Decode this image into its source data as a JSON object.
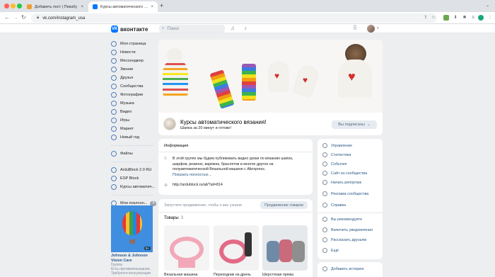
{
  "browser": {
    "tabs": [
      {
        "title": "Добавить пост | Пикабу",
        "active": false
      },
      {
        "title": "Курсы автоматического вязания!",
        "active": true
      }
    ],
    "url": "vk.com/instagram_usa"
  },
  "header": {
    "logo": "вконтакте",
    "search_placeholder": "Поиск"
  },
  "leftnav": {
    "items": [
      {
        "label": "Моя страница",
        "icon": "user-icon"
      },
      {
        "label": "Новости",
        "icon": "news-icon"
      },
      {
        "label": "Мессенджер",
        "icon": "chat-icon"
      },
      {
        "label": "Звонки",
        "icon": "phone-icon"
      },
      {
        "label": "Друзья",
        "icon": "friends-icon"
      },
      {
        "label": "Сообщества",
        "icon": "groups-icon"
      },
      {
        "label": "Фотографии",
        "icon": "photo-icon"
      },
      {
        "label": "Музыка",
        "icon": "music-icon"
      },
      {
        "label": "Видео",
        "icon": "video-icon"
      },
      {
        "label": "Игры",
        "icon": "games-icon"
      },
      {
        "label": "Маркет",
        "icon": "market-icon"
      },
      {
        "label": "Новый год",
        "icon": "newyear-icon"
      }
    ],
    "files": "Файлы",
    "apps": [
      "ArduBlock 2.0 RU",
      "ESP Block",
      "Курсы автоматич..."
    ],
    "more_label": "Мои поклонн...",
    "more_badge": "4"
  },
  "ad": {
    "label": "0+",
    "title": "Johnson & Johnson Vision Care",
    "type": "Группа",
    "desc": "Есть противопоказания. Требуется консультация"
  },
  "group": {
    "name": "Курсы автоматического вязания!",
    "status": "Шапка за 20 минут и готово!",
    "subscribe_label": "Вы подписаны"
  },
  "info": {
    "title": "Информация",
    "description": "В этой группе мы будем публиковать видео уроки по вязанию шапок, шарфов, резинок, варежек, браслетов и многое другое на полуавтоматической Вязальной машине с Aliexpress.",
    "more": "Показать полностью…",
    "link": "http://ardublock.ru/ali/?ali=814"
  },
  "promo": {
    "text": "Запустите продвижение, чтобы о вас узнали",
    "button": "Продвижение товаров"
  },
  "goods": {
    "title": "Товары",
    "count": "3",
    "items": [
      "Вязальная машина",
      "Переходник на дрель",
      "Шерстяная пряжа"
    ]
  },
  "rmenu": {
    "items": [
      {
        "label": "Управление",
        "icon": "settings-icon"
      },
      {
        "label": "Статистика",
        "icon": "stats-icon"
      },
      {
        "label": "События",
        "icon": "events-icon"
      },
      {
        "label": "Сайт из сообщества",
        "icon": "site-icon"
      },
      {
        "label": "Начать репортаж",
        "icon": "live-icon"
      },
      {
        "label": "Реклама сообщества",
        "icon": "ads-icon"
      },
      {
        "label": "Справка",
        "icon": "help-icon"
      }
    ],
    "items2": [
      {
        "label": "Вы рекомендуете",
        "icon": "like-icon"
      },
      {
        "label": "Включить уведомления",
        "icon": "bell-icon"
      },
      {
        "label": "Рассказать друзьям",
        "icon": "share-icon"
      },
      {
        "label": "Ещё",
        "icon": "chevron-down-icon"
      }
    ],
    "story": "Добавить историю"
  }
}
